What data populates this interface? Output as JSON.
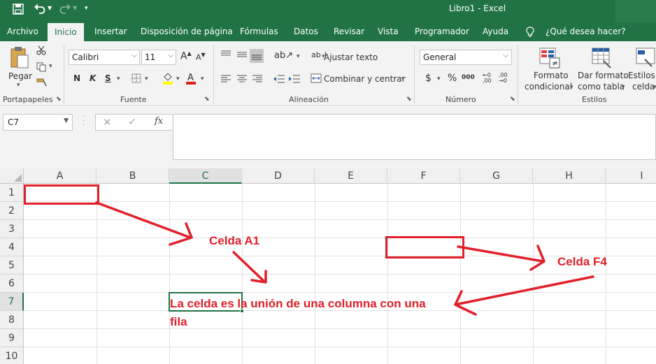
{
  "title_bar": {
    "title": "Libro1  -  Excel"
  },
  "tabs": [
    "Archivo",
    "Inicio",
    "Insertar",
    "Disposición de página",
    "Fórmulas",
    "Datos",
    "Revisar",
    "Vista",
    "Programador",
    "Ayuda"
  ],
  "tell_me": "¿Qué desea hacer?",
  "ribbon": {
    "paste_label": "Pegar",
    "font_name": "Calibri",
    "font_size": "11",
    "bold": "N",
    "italic": "K",
    "underline": "S",
    "wrap_text": "Ajustar texto",
    "merge_center": "Combinar y centrar",
    "number_format": "General",
    "currency": "$",
    "percent": "%",
    "thousands": "000",
    "cond_format_1": "Formato",
    "cond_format_2": "condicional",
    "table_format_1": "Dar formato",
    "table_format_2": "como tabla",
    "cell_styles_1": "Estilos de",
    "cell_styles_2": "celda",
    "groups": {
      "clipboard": "Portapapeles",
      "font": "Fuente",
      "alignment": "Alineación",
      "number": "Número",
      "styles": "Estilos"
    }
  },
  "formula_bar": {
    "name_box": "C7",
    "fx": "fx",
    "content": ""
  },
  "sheet": {
    "columns": [
      "A",
      "B",
      "C",
      "D",
      "E",
      "F",
      "G",
      "H",
      "I"
    ],
    "rows": [
      "1",
      "2",
      "3",
      "4",
      "5",
      "6",
      "7",
      "8",
      "9",
      "10"
    ],
    "selected_cell": "C7"
  },
  "annotations": {
    "a1_label": "Celda A1",
    "f4_label": "Celda F4",
    "note_line1": "La celda es la unión de una columna con una",
    "note_line2": "fila",
    "color": "#e0202a"
  },
  "colors": {
    "excel_green": "#217346",
    "ribbon_bg": "#f3f3f3"
  }
}
